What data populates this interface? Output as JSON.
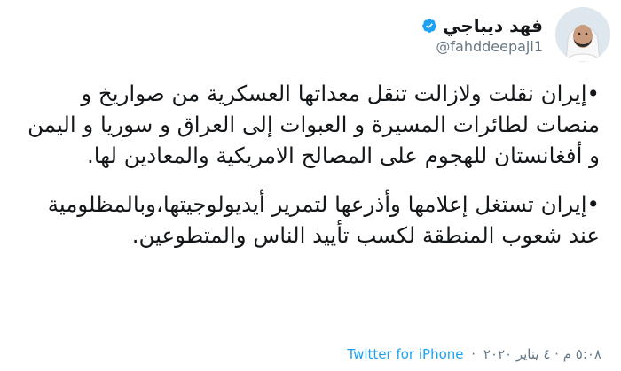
{
  "author": {
    "display_name": "فهد ديباجي",
    "username": "@fahddeepaji1",
    "verified": true,
    "verified_color": "#1DA1F2",
    "avatar_icon": "profile-photo"
  },
  "tweet": {
    "paragraphs": [
      "•إيران نقلت ولازالت تنقل معداتها العسكرية من صواريخ و منصات لطائرات المسيرة و العبوات إلى العراق و سوريا و اليمن و أفغانستان للهجوم على المصالح الامريكية والمعادين لها.",
      "•إيران تستغل إعلامها وأذرعها لتمرير أيديولوجيتها،وبالمظلومية عند شعوب المنطقة لكسب تأييد الناس والمتطوعين."
    ]
  },
  "footer": {
    "timestamp": "٥:٠٨ م · ٤ يناير ٢٠٢٠",
    "separator": "·",
    "client": "Twitter for iPhone"
  },
  "colors": {
    "text": "#14171A",
    "secondary": "#657786",
    "link": "#1DA1F2",
    "background": "#FFFFFF"
  }
}
